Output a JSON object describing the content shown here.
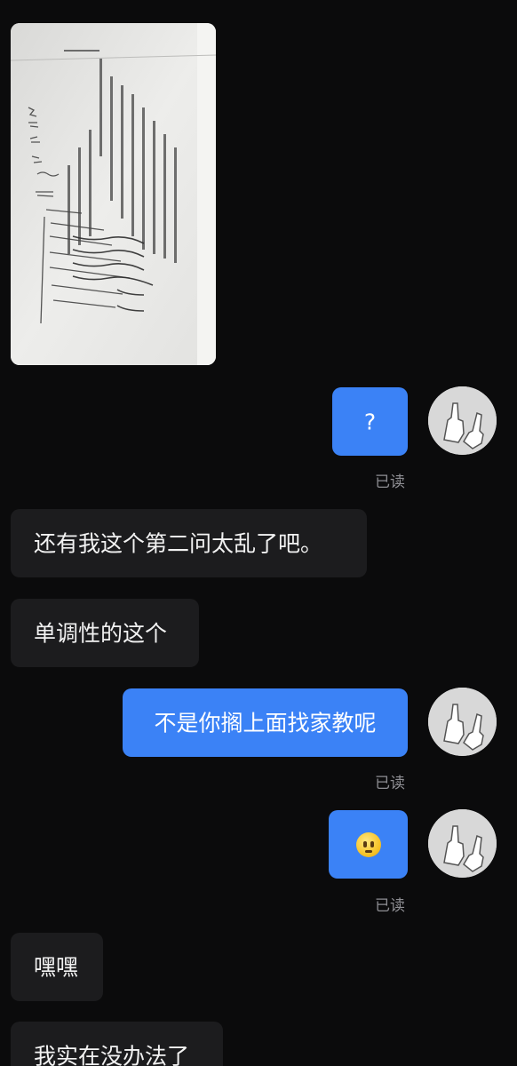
{
  "messages": [
    {
      "type": "image",
      "direction": "incoming",
      "content": "photo-of-handwritten-math-worksheet"
    },
    {
      "type": "text",
      "direction": "outgoing",
      "text": "?",
      "status": "已读"
    },
    {
      "type": "text",
      "direction": "incoming",
      "text": "还有我这个第二问太乱了吧。"
    },
    {
      "type": "text",
      "direction": "incoming",
      "text": "单调性的这个"
    },
    {
      "type": "text",
      "direction": "outgoing",
      "text": "不是你搁上面找家教呢",
      "status": "已读"
    },
    {
      "type": "emoji",
      "direction": "outgoing",
      "emoji": "slightly-flushed-face",
      "status": "已读"
    },
    {
      "type": "text",
      "direction": "incoming",
      "text": "嘿嘿"
    },
    {
      "type": "text",
      "direction": "incoming",
      "text": "我实在没办法了"
    }
  ],
  "colors": {
    "background": "#0b0b0c",
    "incoming_bubble": "#1c1c1e",
    "outgoing_bubble": "#3b82f6",
    "status_text": "#8e8e93"
  },
  "avatar_icon": "middle-fingers-hands-icon"
}
